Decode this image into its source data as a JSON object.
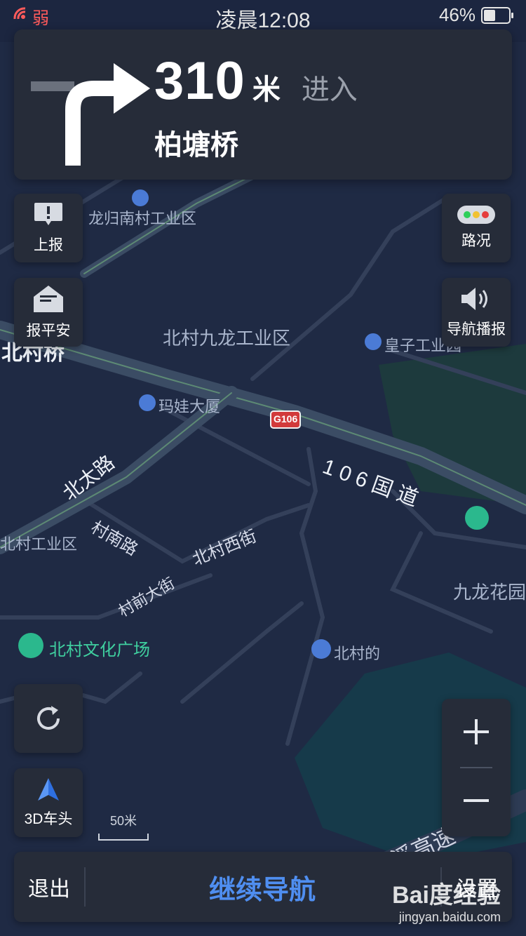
{
  "status": {
    "signal_label": "弱",
    "time": "凌晨12:08",
    "battery_text": "46%",
    "battery_level": 0.46
  },
  "guidance": {
    "distance": "310",
    "unit": "米",
    "action": "进入",
    "road": "柏塘桥"
  },
  "buttons": {
    "report": "上报",
    "safety": "报平安",
    "traffic": "路况",
    "voice": "导航播报",
    "view_mode": "3D车头"
  },
  "scale_label": "50米",
  "map_labels": {
    "longgui": "龙归南村工业区",
    "jiulong_ind": "北村九龙工业区",
    "huangzi": "皇子工业园",
    "beicunqiao": "北村桥",
    "mawa": "玛娃大厦",
    "g106": "G106",
    "guodao": "106国道",
    "beitai": "北太路",
    "cunnan": "村南路",
    "beicunxi": "北村西街",
    "cunqian": "村前大街",
    "cunind": "北村工业区",
    "jiulong_garden": "九龙花园",
    "culture_square": "北村文化广场",
    "beicunde": "北村的",
    "expressway": "流溪高速"
  },
  "bottom": {
    "exit": "退出",
    "continue": "继续导航",
    "settings": "设置"
  },
  "watermark": {
    "brand": "Bai度经验",
    "url": "jingyan.baidu.com"
  },
  "colors": {
    "background": "#1f2a44",
    "panel": "#262c39",
    "accent": "#4f8ef0",
    "weak_signal": "#ff5b5b"
  }
}
